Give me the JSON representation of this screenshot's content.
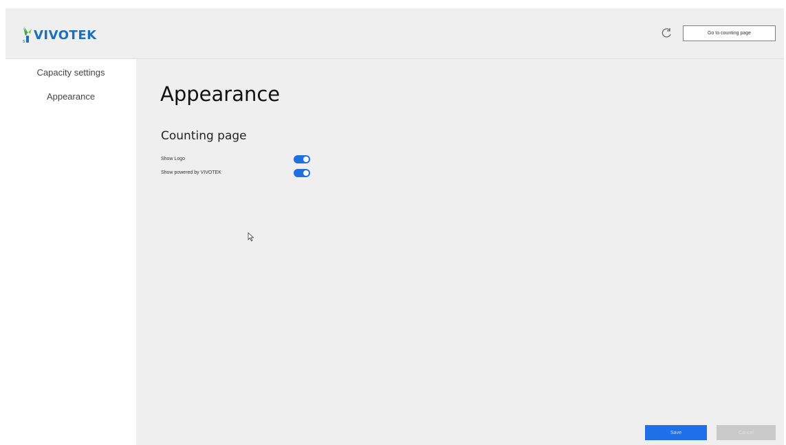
{
  "header": {
    "logo_text": "VIVOTEK",
    "go_button_label": "Go to counting page",
    "brand_color": "#1d6fb8",
    "refresh_icon": "refresh-icon"
  },
  "sidebar": {
    "items": [
      {
        "label": "Capacity settings"
      },
      {
        "label": "Appearance"
      }
    ]
  },
  "main": {
    "title": "Appearance",
    "section_title": "Counting page",
    "settings": [
      {
        "label": "Show Logo",
        "enabled": true
      },
      {
        "label": "Show powered by VIVOTEK",
        "enabled": true
      }
    ],
    "toggle_color": "#1f6fe0"
  },
  "footer": {
    "save_label": "Save",
    "cancel_label": "Cancel",
    "save_color": "#1f6fe8"
  }
}
